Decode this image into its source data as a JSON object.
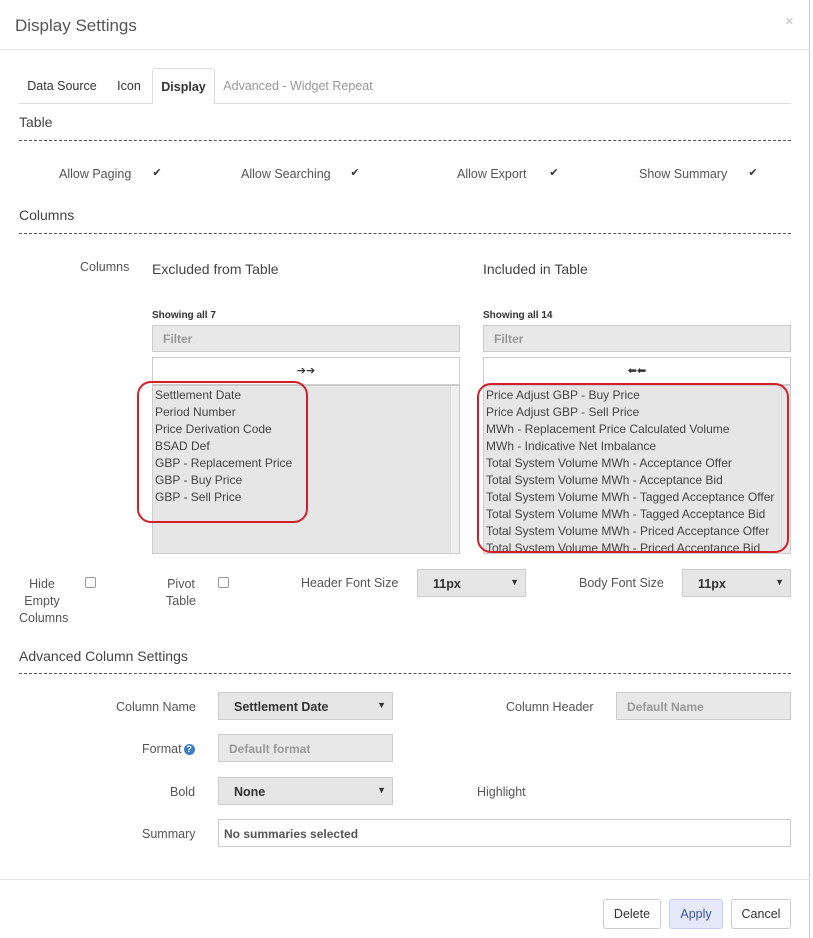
{
  "dialog": {
    "title": "Display Settings",
    "close_glyph": "×"
  },
  "tabs": [
    {
      "label": "Data Source"
    },
    {
      "label": "Icon"
    },
    {
      "label": "Display"
    },
    {
      "label": "Advanced - Widget Repeat"
    }
  ],
  "table_section": {
    "heading": "Table",
    "options": [
      {
        "label": "Allow Paging",
        "checked": true
      },
      {
        "label": "Allow Searching",
        "checked": true
      },
      {
        "label": "Allow Export",
        "checked": true
      },
      {
        "label": "Show Summary",
        "checked": true
      }
    ],
    "check_glyph": "✔"
  },
  "columns_section": {
    "heading": "Columns",
    "label": "Columns",
    "excluded": {
      "title": "Excluded from Table",
      "showing": "Showing all 7",
      "filter_placeholder": "Filter",
      "move_glyph": "➔➔",
      "items": [
        "Settlement Date",
        "Period Number",
        "Price Derivation Code",
        "BSAD Def",
        "GBP - Replacement Price",
        "GBP - Buy Price",
        "GBP - Sell Price"
      ]
    },
    "included": {
      "title": "Included in Table",
      "showing": "Showing all 14",
      "filter_placeholder": "Filter",
      "move_glyph": "⬅⬅",
      "items": [
        "Price Adjust GBP - Buy Price",
        "Price Adjust GBP - Sell Price",
        "MWh - Replacement Price Calculated Volume",
        "MWh - Indicative Net Imbalance",
        "Total System Volume MWh - Acceptance Offer",
        "Total System Volume MWh - Acceptance Bid",
        "Total System Volume MWh - Tagged Acceptance Offer",
        "Total System Volume MWh - Tagged Acceptance Bid",
        "Total System Volume MWh - Priced Acceptance Offer",
        "Total System Volume MWh - Priced Acceptance Bid"
      ]
    }
  },
  "table_options": {
    "hide_empty_columns": {
      "line1": "Hide",
      "line2": "Empty",
      "line3": "Columns"
    },
    "pivot_table": {
      "line1": "Pivot",
      "line2": "Table"
    },
    "header_font_size": {
      "label": "Header Font Size",
      "value": "11px"
    },
    "body_font_size": {
      "label": "Body Font Size",
      "value": "11px"
    },
    "caret": "▼"
  },
  "advanced": {
    "heading": "Advanced Column Settings",
    "column_name": {
      "label": "Column Name",
      "value": "Settlement Date"
    },
    "column_header": {
      "label": "Column Header",
      "placeholder": "Default Name"
    },
    "format": {
      "label": "Format",
      "help": "?",
      "placeholder": "Default format"
    },
    "bold": {
      "label": "Bold",
      "value": "None"
    },
    "highlight": {
      "label": "Highlight"
    },
    "summary": {
      "label": "Summary",
      "value": "No summaries selected"
    }
  },
  "footer": {
    "delete_label": "Delete",
    "apply_label": "Apply",
    "cancel_label": "Cancel"
  }
}
